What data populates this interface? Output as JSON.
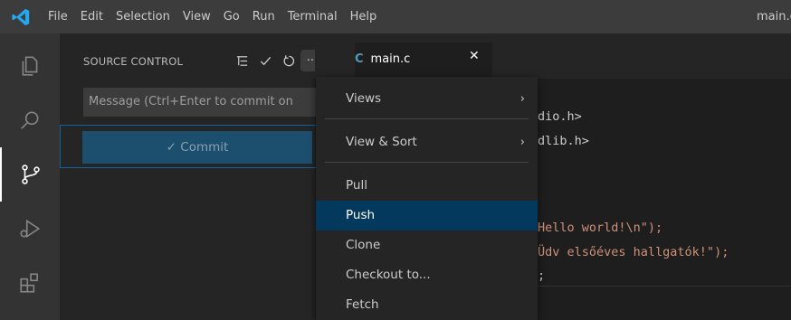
{
  "menu": {
    "items": [
      "File",
      "Edit",
      "Selection",
      "View",
      "Go",
      "Run",
      "Terminal",
      "Help"
    ],
    "window_title": "main.c"
  },
  "activity_bar": {
    "icons": [
      "explorer-icon",
      "search-icon",
      "source-control-icon",
      "run-debug-icon",
      "extensions-icon"
    ]
  },
  "source_control": {
    "title": "SOURCE CONTROL",
    "message_placeholder": "Message (Ctrl+Enter to commit on",
    "commit_label": "✓ Commit",
    "more_label": "···"
  },
  "editor": {
    "tab_icon": "C",
    "tab_label": "main.c",
    "tab_close": "✕",
    "code_lines": [
      {
        "plain": "dio.h>",
        "str": ""
      },
      {
        "plain": "dlib.h>",
        "str": ""
      },
      {
        "plain": "",
        "str": "Hello world!\\n\");"
      },
      {
        "plain": "",
        "str": "Üdv elsőéves hallgatók!\");"
      },
      {
        "plain": ";",
        "str": ""
      }
    ]
  },
  "context_menu": {
    "items": [
      {
        "label": "Views",
        "submenu": true
      },
      {
        "label": "View & Sort",
        "submenu": true
      },
      {
        "label": "Pull",
        "submenu": false
      },
      {
        "label": "Push",
        "submenu": false
      },
      {
        "label": "Clone",
        "submenu": false
      },
      {
        "label": "Checkout to...",
        "submenu": false
      },
      {
        "label": "Fetch",
        "submenu": false
      }
    ],
    "selected": "Push",
    "submenu_glyph": "›"
  },
  "colors": {
    "accent": "#0e639c",
    "selection": "#04395e",
    "string": "#ce9178"
  }
}
